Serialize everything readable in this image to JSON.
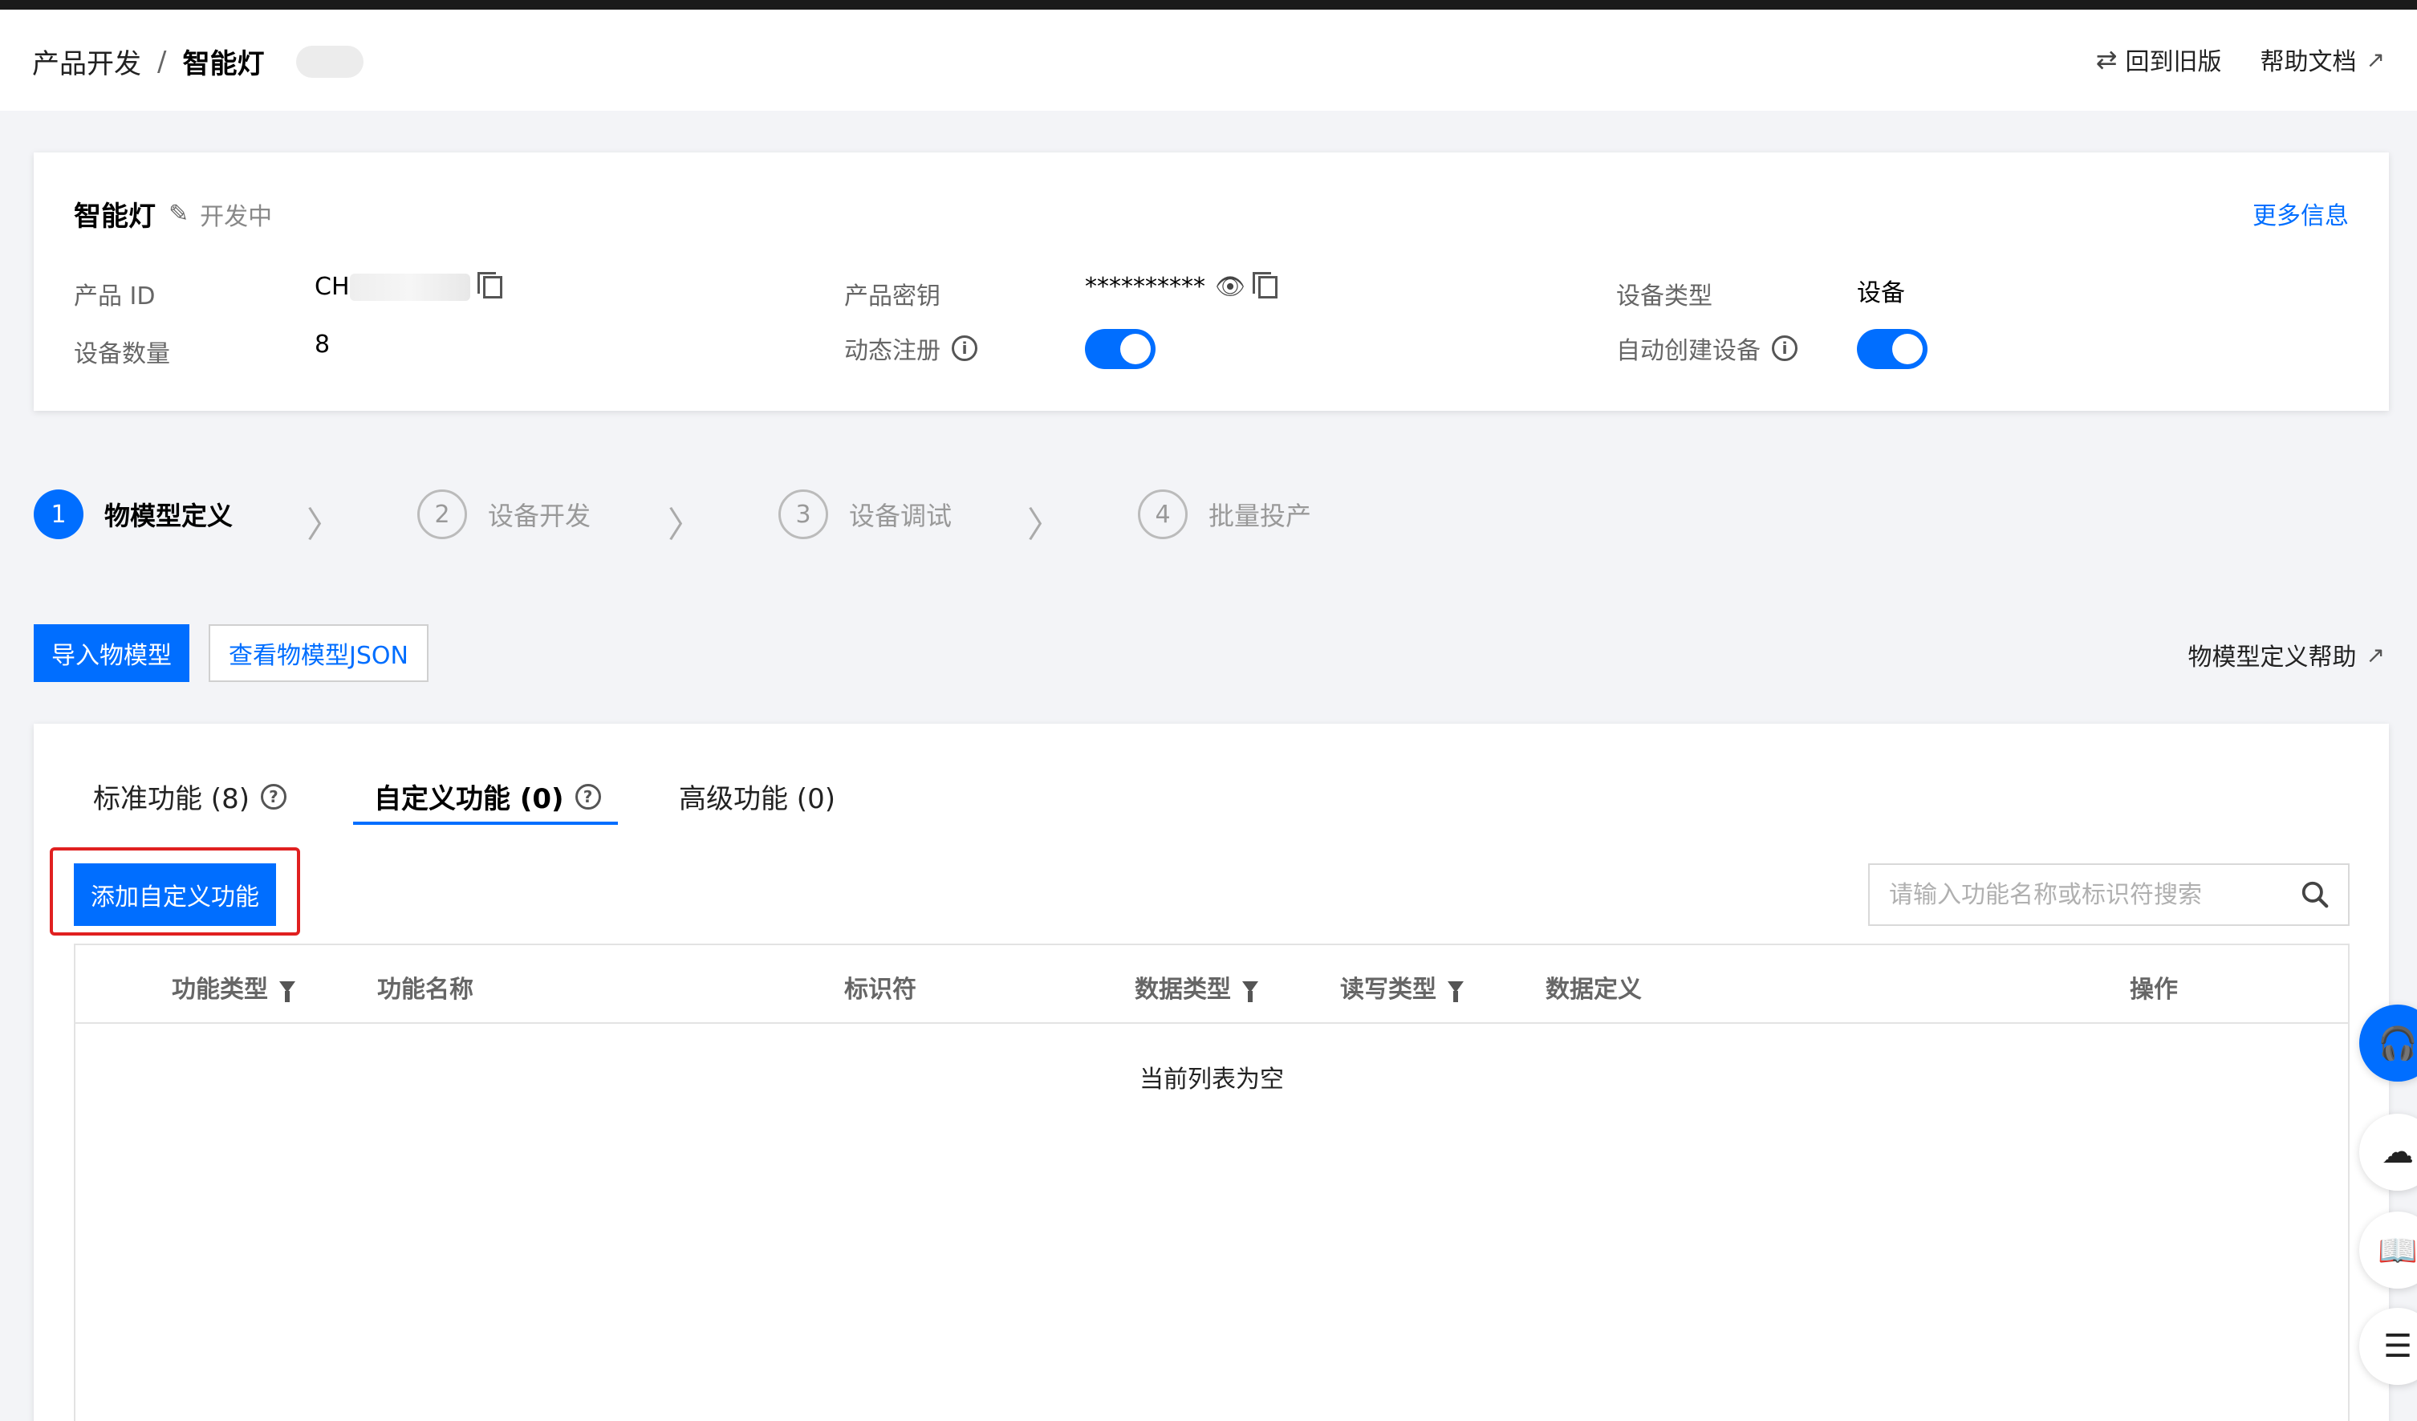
{
  "breadcrumb": {
    "parent": "产品开发",
    "separator": "/",
    "current": "智能灯"
  },
  "header": {
    "old_version": "回到旧版",
    "help_docs": "帮助文档"
  },
  "product": {
    "name": "智能灯",
    "status": "开发中",
    "more_info": "更多信息",
    "fields": {
      "product_id_label": "产品 ID",
      "product_id_value": "CH",
      "product_secret_label": "产品密钥",
      "product_secret_value": "**********",
      "device_type_label": "设备类型",
      "device_type_value": "设备",
      "device_count_label": "设备数量",
      "device_count_value": "8",
      "dynamic_register_label": "动态注册",
      "dynamic_register_enabled": true,
      "auto_create_label": "自动创建设备",
      "auto_create_enabled": true
    }
  },
  "steps": [
    {
      "number": "1",
      "label": "物模型定义",
      "active": true
    },
    {
      "number": "2",
      "label": "设备开发",
      "active": false
    },
    {
      "number": "3",
      "label": "设备调试",
      "active": false
    },
    {
      "number": "4",
      "label": "批量投产",
      "active": false
    }
  ],
  "actions": {
    "import_model": "导入物模型",
    "view_json": "查看物模型JSON",
    "model_help": "物模型定义帮助"
  },
  "tabs": [
    {
      "label": "标准功能 (8)",
      "has_help": true,
      "active": false
    },
    {
      "label": "自定义功能 (0)",
      "has_help": true,
      "active": true
    },
    {
      "label": "高级功能 (0)",
      "has_help": false,
      "active": false
    }
  ],
  "add_button": "添加自定义功能",
  "search": {
    "placeholder": "请输入功能名称或标识符搜索",
    "value": ""
  },
  "table": {
    "columns": [
      {
        "label": "功能类型",
        "filter": true
      },
      {
        "label": "功能名称",
        "filter": false
      },
      {
        "label": "标识符",
        "filter": false
      },
      {
        "label": "数据类型",
        "filter": true
      },
      {
        "label": "读写类型",
        "filter": true
      },
      {
        "label": "数据定义",
        "filter": false
      },
      {
        "label": "操作",
        "filter": false
      }
    ],
    "empty_text": "当前列表为空"
  },
  "colors": {
    "accent": "#006eff",
    "highlight": "#e02020"
  },
  "float_icons": [
    "headset-icon",
    "cloud-icon",
    "book-icon",
    "list-icon"
  ]
}
